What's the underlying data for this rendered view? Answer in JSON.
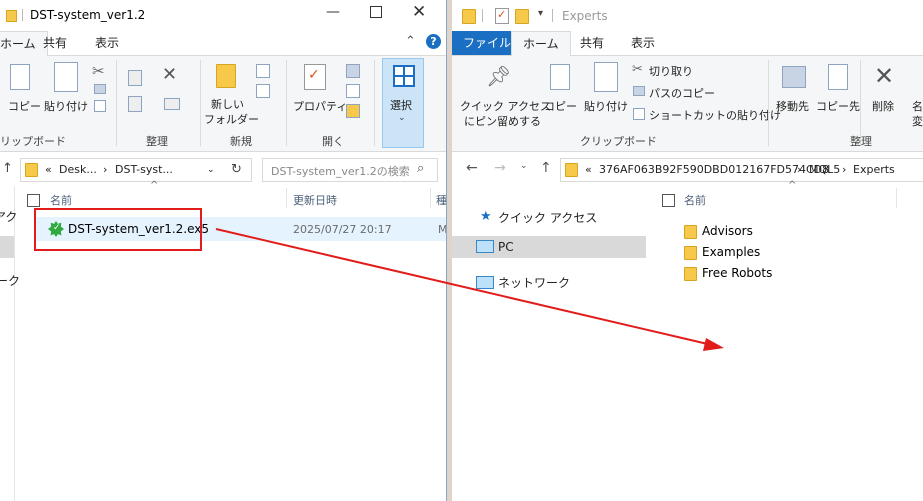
{
  "left": {
    "title": "DST-system_ver1.2",
    "tabs": [
      "ホーム",
      "共有",
      "表示"
    ],
    "ribbon": {
      "copy": "コピー",
      "paste": "貼り付け",
      "group_clipboard": "リップボード",
      "group_organize": "整理",
      "new_folder_1": "新しい",
      "new_folder_2": "フォルダー",
      "group_new": "新規",
      "properties": "プロパティ",
      "group_open": "開く",
      "select": "選択"
    },
    "address": {
      "prefix": "«",
      "crumb1": "Desk...",
      "sep": "›",
      "crumb2": "DST-syst..."
    },
    "search_placeholder": "DST-system_ver1.2の検索",
    "columns": {
      "name": "名前",
      "date": "更新日時",
      "type": "種"
    },
    "file": {
      "name": "DST-system_ver1.2.ex5",
      "date": "2025/07/27 20:17",
      "type_partial": "M"
    },
    "nav_partial": [
      "アク",
      "ーク"
    ]
  },
  "right": {
    "title": "Experts",
    "tabs": [
      "ファイル",
      "ホーム",
      "共有",
      "表示"
    ],
    "ribbon": {
      "pin_1": "クイック アクセス",
      "pin_2": "にピン留めする",
      "copy": "コピー",
      "paste": "貼り付け",
      "cut": "切り取り",
      "copy_path": "パスのコピー",
      "paste_shortcut": "ショートカットの貼り付け",
      "group_clipboard": "クリップボード",
      "move_to": "移動先",
      "copy_to": "コピー先",
      "delete": "削除",
      "rename_partial_1": "名",
      "rename_partial_2": "変",
      "group_organize": "整理"
    },
    "address": {
      "prefix": "«",
      "crumb1": "376AF063B92F590DBD012167FD574CD8",
      "crumb2": "MQL5",
      "crumb3": "Experts",
      "sep": "›"
    },
    "nav": [
      "クイック アクセス",
      "PC",
      "ネットワーク"
    ],
    "column_name": "名前",
    "folders": [
      "Advisors",
      "Examples",
      "Free Robots"
    ]
  },
  "colors": {
    "accent": "#1a6fc2",
    "highlight": "#e21b1b",
    "selected_nav": "#d9d9d9",
    "folder": "#f6c94a"
  }
}
